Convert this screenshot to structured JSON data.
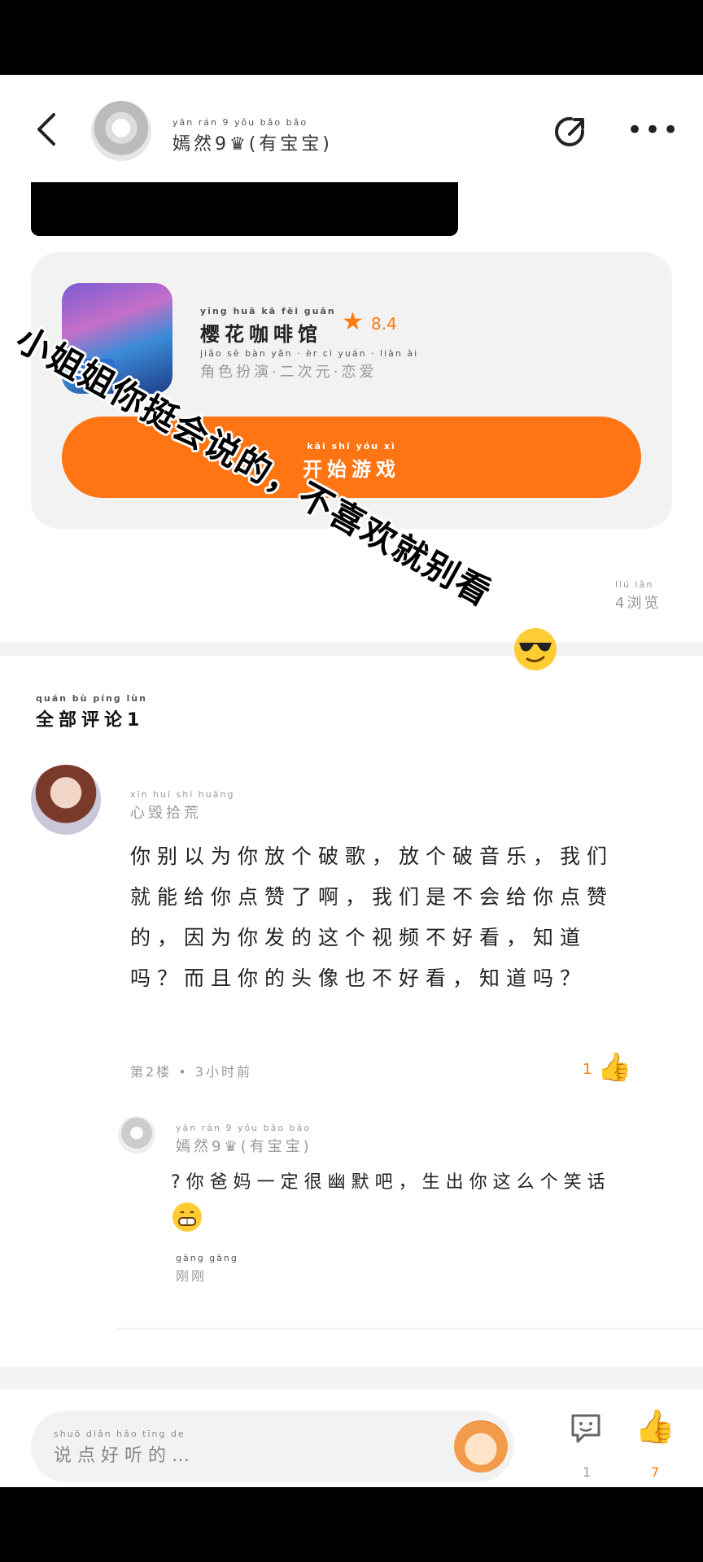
{
  "header": {
    "user_name_pinyin": "yān rán 9 yǒu bǎo bǎo",
    "user_name": "嫣然9♛(有宝宝)"
  },
  "game": {
    "logo_text": "Sak",
    "title_pinyin": "yīng huā kā fēi guǎn",
    "title": "樱花咖啡馆",
    "rating": "8.4",
    "tags_pinyin": "jiǎo sè bàn yǎn · èr cì yuán · liàn ài",
    "tags": "角色扮演·二次元·恋爱",
    "start_pinyin": "kāi shǐ yóu xì",
    "start_label": "开始游戏"
  },
  "views": {
    "pinyin": "liú lǎn",
    "text": "4浏览"
  },
  "comments_section": {
    "title_pinyin": "quán bù píng lùn",
    "title": "全部评论1"
  },
  "comment": {
    "author_pinyin": "xīn huī shí huāng",
    "author": "心毁拾荒",
    "body": "你别以为你放个破歌，放个破音乐，我们就能给你点赞了啊，我们是不会给你点赞的，因为你发的这个视频不好看，知道吗？而且你的头像也不好看，知道吗？",
    "meta": "第2楼 • 3小时前",
    "like_count": "1"
  },
  "reply": {
    "author_pinyin": "yān rán 9 yǒu bǎo bǎo",
    "author": "嫣然9♛(有宝宝)",
    "body": "?你爸妈一定很幽默吧，生出你这么个笑话",
    "time_pinyin": "gāng gāng",
    "time": "刚刚"
  },
  "bottom_bar": {
    "input_pinyin": "shuō diǎn hǎo tīng de",
    "input_placeholder": "说点好听的…",
    "comment_count": "1",
    "like_count": "7"
  },
  "overlay": {
    "caption": "小姐姐你挺会说的，不喜欢就别看"
  },
  "colors": {
    "accent": "#ff7513",
    "card_bg": "#f2f2f2",
    "muted_text": "#999999"
  }
}
